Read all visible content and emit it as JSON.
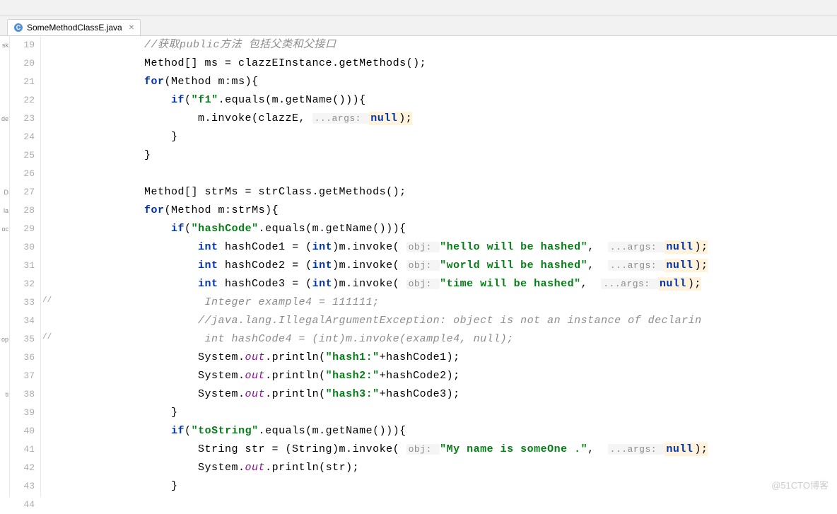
{
  "tab": {
    "filename": "SomeMethodClassE.java",
    "icon_letter": "C"
  },
  "line_numbers": [
    "19",
    "20",
    "21",
    "22",
    "23",
    "24",
    "25",
    "26",
    "27",
    "28",
    "29",
    "30",
    "31",
    "32",
    "33",
    "34",
    "35",
    "36",
    "37",
    "38",
    "39",
    "40",
    "41",
    "42",
    "43",
    "44"
  ],
  "left_markers": {
    "0": "sk",
    "4": "de",
    "8": "D",
    "9": "la",
    "10": "oc",
    "16": "op",
    "19": "ti"
  },
  "fold_comments": {
    "14": "//",
    "16": "//"
  },
  "code": {
    "l19": {
      "indent": "            ",
      "comment": "//获取public方法 包括父类和父接口"
    },
    "l20": {
      "indent": "            ",
      "text1": "Method[] ms = clazzEInstance.getMethods();"
    },
    "l21": {
      "indent": "            ",
      "kw": "for",
      "text": "(Method m:ms){"
    },
    "l22": {
      "indent": "                ",
      "kw": "if",
      "text1": "(",
      "str": "\"f1\"",
      "text2": ".equals(m.getName())){"
    },
    "l23": {
      "indent": "                    ",
      "text1": "m.invoke(clazzE, ",
      "hint": "...args: ",
      "null": "null",
      "text2": ");"
    },
    "l24": {
      "indent": "                ",
      "text": "}"
    },
    "l25": {
      "indent": "            ",
      "text": "}"
    },
    "l26": {
      "text": ""
    },
    "l27": {
      "indent": "            ",
      "text": "Method[] strMs = strClass.getMethods();"
    },
    "l28": {
      "indent": "            ",
      "kw": "for",
      "text": "(Method m:strMs){"
    },
    "l29": {
      "indent": "                ",
      "kw": "if",
      "text1": "(",
      "str": "\"hashCode\"",
      "text2": ".equals(m.getName())){"
    },
    "l30": {
      "indent": "                    ",
      "kw": "int",
      "text1": " hashCode1 = (",
      "kw2": "int",
      "text2": ")m.invoke( ",
      "hint1": "obj: ",
      "str": "\"hello will be hashed\"",
      "text3": ",  ",
      "hint2": "...args: ",
      "null": "null",
      "text4": ");"
    },
    "l31": {
      "indent": "                    ",
      "kw": "int",
      "text1": " hashCode2 = (",
      "kw2": "int",
      "text2": ")m.invoke( ",
      "hint1": "obj: ",
      "str": "\"world will be hashed\"",
      "text3": ",  ",
      "hint2": "...args: ",
      "null": "null",
      "text4": ");"
    },
    "l32": {
      "indent": "                    ",
      "kw": "int",
      "text1": " hashCode3 = (",
      "kw2": "int",
      "text2": ")m.invoke( ",
      "hint1": "obj: ",
      "str": "\"time will be hashed\"",
      "text3": ",  ",
      "hint2": "...args: ",
      "null": "null",
      "text4": ");"
    },
    "l33": {
      "indent": "                     ",
      "comment": "Integer example4 = 111111;"
    },
    "l34": {
      "indent": "                    ",
      "comment": "//java.lang.IllegalArgumentException: object is not an instance of declarin"
    },
    "l35": {
      "indent": "                     ",
      "comment": "int hashCode4 = (int)m.invoke(example4, null);"
    },
    "l36": {
      "indent": "                    ",
      "text1": "System.",
      "field": "out",
      "text2": ".println(",
      "str": "\"hash1:\"",
      "text3": "+hashCode1);"
    },
    "l37": {
      "indent": "                    ",
      "text1": "System.",
      "field": "out",
      "text2": ".println(",
      "str": "\"hash2:\"",
      "text3": "+hashCode2);"
    },
    "l38": {
      "indent": "                    ",
      "text1": "System.",
      "field": "out",
      "text2": ".println(",
      "str": "\"hash3:\"",
      "text3": "+hashCode3);"
    },
    "l39": {
      "indent": "                ",
      "text": "}"
    },
    "l40": {
      "indent": "                ",
      "kw": "if",
      "text1": "(",
      "str": "\"toString\"",
      "text2": ".equals(m.getName())){"
    },
    "l41": {
      "indent": "                    ",
      "text1": "String str = (String)m.invoke( ",
      "hint1": "obj: ",
      "str": "\"My name is someOne .\"",
      "text2": ",  ",
      "hint2": "...args: ",
      "null": "null",
      "text3": ");"
    },
    "l42": {
      "indent": "                    ",
      "text1": "System.",
      "field": "out",
      "text2": ".println(str);"
    },
    "l43": {
      "indent": "                ",
      "text": "}"
    },
    "l44": {
      "text": ""
    }
  },
  "watermark": "@51CTO博客"
}
